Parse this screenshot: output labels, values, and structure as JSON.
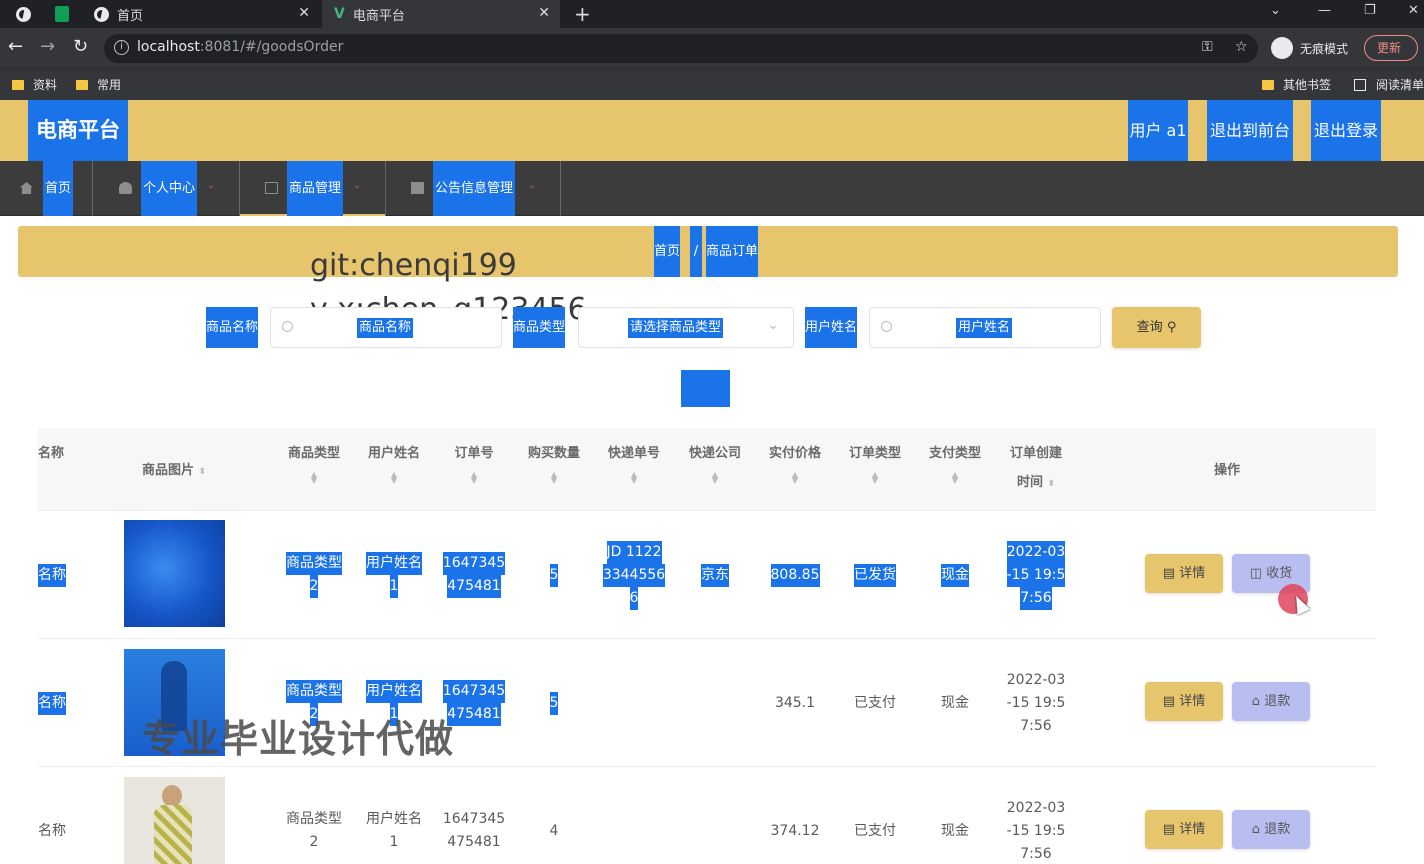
{
  "browser": {
    "tabs": [
      {
        "title": "首页"
      },
      {
        "title": "电商平台"
      }
    ],
    "new_tab": "+",
    "url_host": "localhost",
    "url_rest": ":8081/#/goodsOrder",
    "incognito_label": "无痕模式",
    "update_label": "更新",
    "bookmarks": [
      "资料",
      "常用"
    ],
    "bookmarks_right": [
      "其他书签",
      "阅读清单"
    ]
  },
  "header": {
    "brand": "电商平台",
    "user": "用户 a1",
    "to_front": "退出到前台",
    "logout": "退出登录"
  },
  "nav": [
    {
      "label": "首页"
    },
    {
      "label": "个人中心"
    },
    {
      "label": "商品管理"
    },
    {
      "label": "公告信息管理"
    }
  ],
  "breadcrumb": {
    "home": "首页",
    "sep": "/",
    "current": "商品订单"
  },
  "watermarks": {
    "line1": "git:chenqi199",
    "line2": "v x:chen_q123456",
    "line3": "专业毕业设计代做"
  },
  "search": {
    "name_label": "商品名称",
    "name_placeholder": "商品名称",
    "type_label": "商品类型",
    "type_placeholder": "请选择商品类型",
    "user_label": "用户姓名",
    "user_placeholder": "用户姓名",
    "query_label": "查询"
  },
  "table": {
    "columns": {
      "name": "名称",
      "image": "商品图片",
      "type": "商品类型",
      "user": "用户姓名",
      "order_no": "订单号",
      "qty": "购买数量",
      "express_no": "快递单号",
      "express_co": "快递公司",
      "price": "实付价格",
      "order_type": "订单类型",
      "pay_type": "支付类型",
      "created_1": "订单创建",
      "created_2": "时间",
      "ops": "操作"
    },
    "rows": [
      {
        "name": "名称",
        "type_1": "商品类型",
        "type_2": "2",
        "user_1": "用户姓名",
        "user_2": "1",
        "order_1": "1647345",
        "order_2": "475481",
        "qty": "5",
        "express_1": "JD 1122",
        "express_2": "3344556",
        "express_3": "6",
        "express_co": "京东",
        "price": "808.85",
        "order_type": "已发货",
        "pay_type": "现金",
        "created_1": "2022-03",
        "created_2": "-15 19:5",
        "created_3": "7:56",
        "detail": "详情",
        "action": "收货"
      },
      {
        "name": "名称",
        "type_1": "商品类型",
        "type_2": "2",
        "user_1": "用户姓名",
        "user_2": "1",
        "order_1": "1647345",
        "order_2": "475481",
        "qty": "5",
        "price": "345.1",
        "order_type": "已支付",
        "pay_type": "现金",
        "created_1": "2022-03",
        "created_2": "-15 19:5",
        "created_3": "7:56",
        "detail": "详情",
        "action": "退款"
      },
      {
        "name": "名称",
        "type_1": "商品类型",
        "type_2": "2",
        "user_1": "用户姓名",
        "user_2": "1",
        "order_1": "1647345",
        "order_2": "475481",
        "qty": "4",
        "price": "374.12",
        "order_type": "已支付",
        "pay_type": "现金",
        "created_1": "2022-03",
        "created_2": "-15 19:5",
        "created_3": "7:56",
        "detail": "详情",
        "action": "退款"
      }
    ]
  },
  "colors": {
    "accent": "#e6c56c",
    "selection": "#1a73e8",
    "nav_bg": "#3c3c3c",
    "action_button": "#b8bff0"
  }
}
